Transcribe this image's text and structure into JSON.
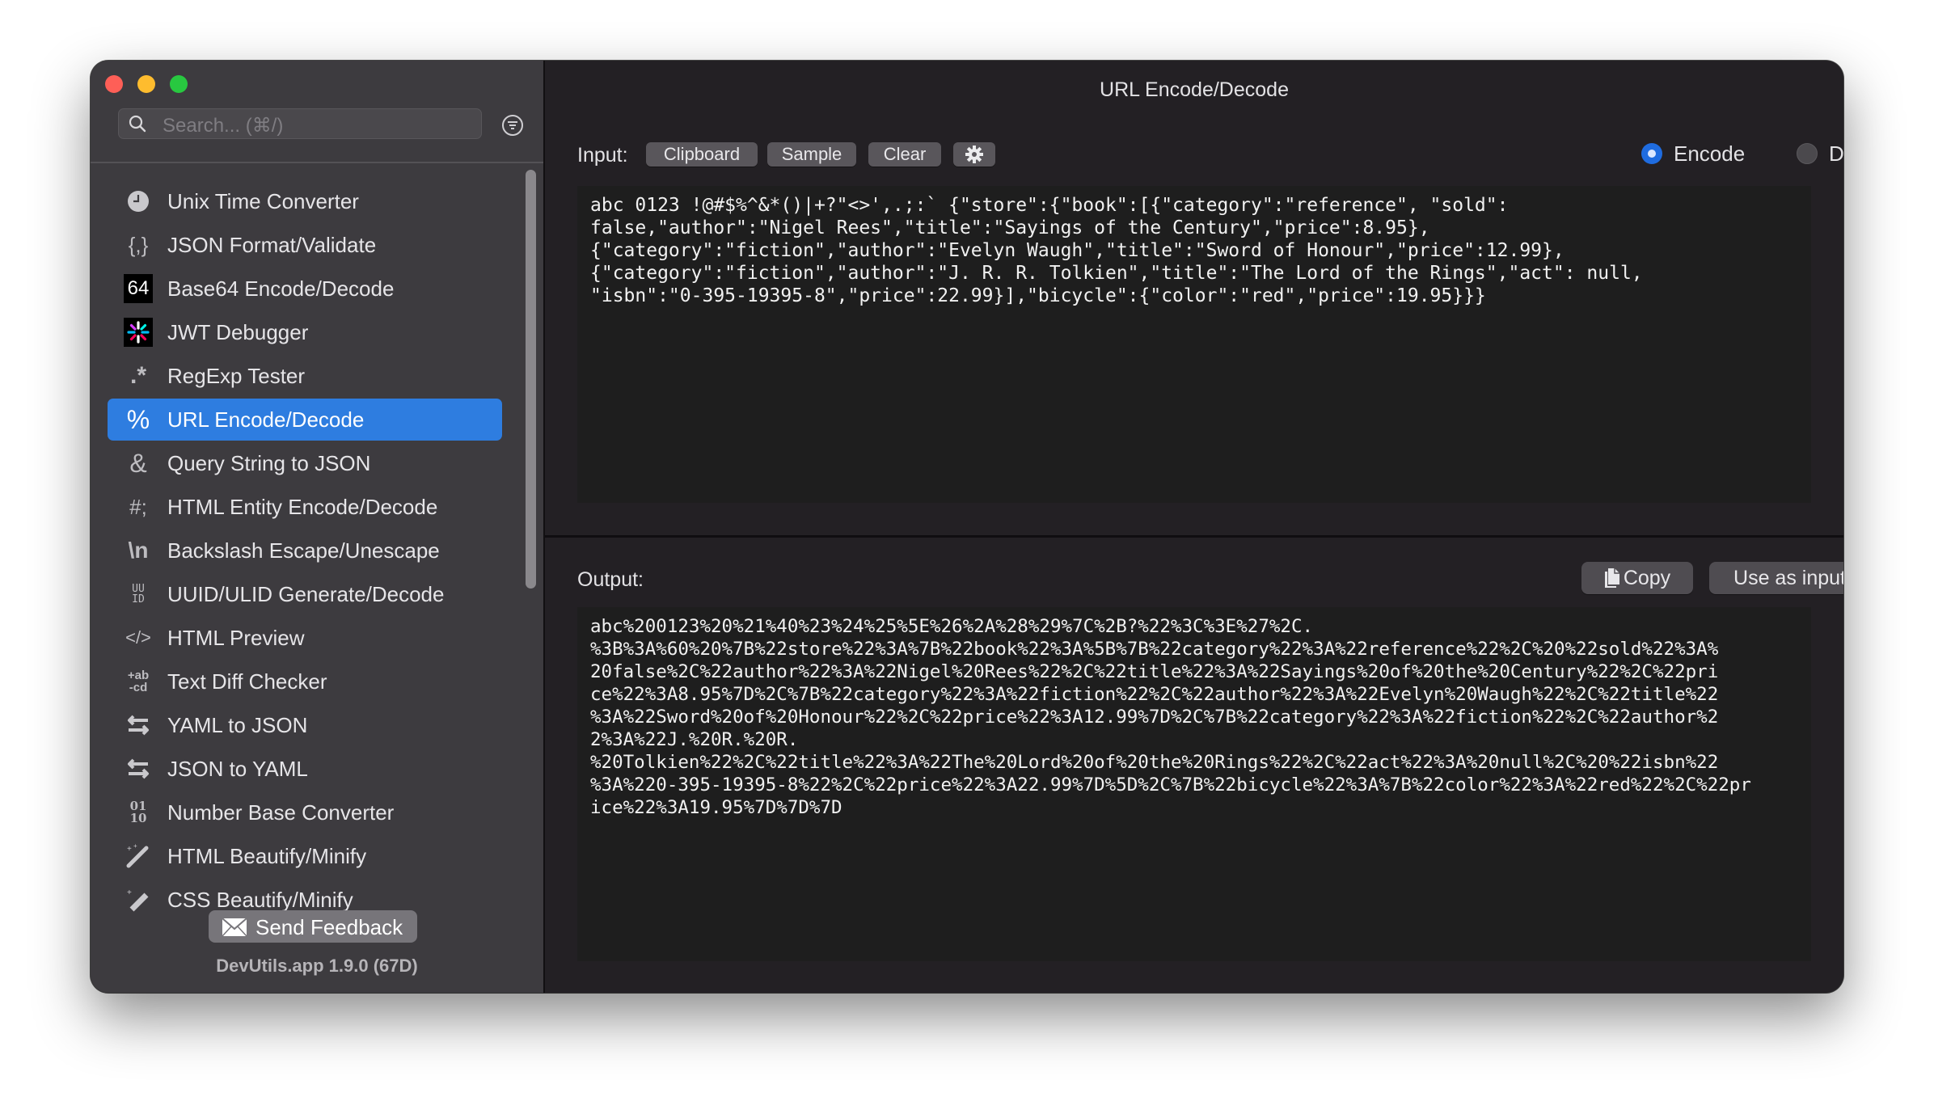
{
  "window": {
    "title": "URL Encode/Decode"
  },
  "sidebar": {
    "search_placeholder": "Search... (⌘/)",
    "items": [
      {
        "label": "Unix Time Converter",
        "icon": "clock-icon",
        "glyph": "🕘"
      },
      {
        "label": "JSON Format/Validate",
        "icon": "json-braces-icon",
        "glyph": "{,}"
      },
      {
        "label": "Base64 Encode/Decode",
        "icon": "base64-icon",
        "glyph": "64"
      },
      {
        "label": "JWT Debugger",
        "icon": "jwt-icon",
        "glyph": "✳"
      },
      {
        "label": "RegExp Tester",
        "icon": "regex-icon",
        "glyph": ".*"
      },
      {
        "label": "URL Encode/Decode",
        "icon": "percent-icon",
        "glyph": "%",
        "active": true
      },
      {
        "label": "Query String to JSON",
        "icon": "ampersand-icon",
        "glyph": "&"
      },
      {
        "label": "HTML Entity Encode/Decode",
        "icon": "hash-semicolon-icon",
        "glyph": "#;"
      },
      {
        "label": "Backslash Escape/Unescape",
        "icon": "backslash-n-icon",
        "glyph": "\\n"
      },
      {
        "label": "UUID/ULID Generate/Decode",
        "icon": "uuid-icon",
        "glyph": "UU ID"
      },
      {
        "label": "HTML Preview",
        "icon": "code-brackets-icon",
        "glyph": "</>"
      },
      {
        "label": "Text Diff Checker",
        "icon": "diff-icon",
        "glyph": "+ab -cd"
      },
      {
        "label": "YAML to JSON",
        "icon": "swap-arrows-icon",
        "glyph": "⇆"
      },
      {
        "label": "JSON to YAML",
        "icon": "swap-arrows-icon",
        "glyph": "⇆"
      },
      {
        "label": "Number Base Converter",
        "icon": "binary-icon",
        "glyph": "01 10"
      },
      {
        "label": "HTML Beautify/Minify",
        "icon": "magic-wand-icon",
        "glyph": "⁺╱"
      },
      {
        "label": "CSS Beautify/Minify",
        "icon": "magic-eraser-icon",
        "glyph": "⁺⧄"
      }
    ],
    "feedback_label": "Send Feedback",
    "version": "DevUtils.app 1.9.0 (67D)"
  },
  "input": {
    "label": "Input:",
    "buttons": {
      "clipboard": "Clipboard",
      "sample": "Sample",
      "clear": "Clear"
    },
    "modes": {
      "encode": "Encode",
      "decode": "Decode",
      "selected": "encode"
    },
    "text": "abc 0123 !@#$%^&*()|+?\"<>',.;:` {\"store\":{\"book\":[{\"category\":\"reference\", \"sold\":\nfalse,\"author\":\"Nigel Rees\",\"title\":\"Sayings of the Century\",\"price\":8.95},\n{\"category\":\"fiction\",\"author\":\"Evelyn Waugh\",\"title\":\"Sword of Honour\",\"price\":12.99},\n{\"category\":\"fiction\",\"author\":\"J. R. R. Tolkien\",\"title\":\"The Lord of the Rings\",\"act\": null,\n\"isbn\":\"0-395-19395-8\",\"price\":22.99}],\"bicycle\":{\"color\":\"red\",\"price\":19.95}}}"
  },
  "output": {
    "label": "Output:",
    "copy_label": "Copy",
    "use_as_input_label": "Use as input",
    "text": "abc%200123%20%21%40%23%24%25%5E%26%2A%28%29%7C%2B?%22%3C%3E%27%2C.\n%3B%3A%60%20%7B%22store%22%3A%7B%22book%22%3A%5B%7B%22category%22%3A%22reference%22%2C%20%22sold%22%3A%\n20false%2C%22author%22%3A%22Nigel%20Rees%22%2C%22title%22%3A%22Sayings%20of%20the%20Century%22%2C%22pri\nce%22%3A8.95%7D%2C%7B%22category%22%3A%22fiction%22%2C%22author%22%3A%22Evelyn%20Waugh%22%2C%22title%22\n%3A%22Sword%20of%20Honour%22%2C%22price%22%3A12.99%7D%2C%7B%22category%22%3A%22fiction%22%2C%22author%2\n2%3A%22J.%20R.%20R.\n%20Tolkien%22%2C%22title%22%3A%22The%20Lord%20of%20the%20Rings%22%2C%22act%22%3A%20null%2C%20%22isbn%22\n%3A%220-395-19395-8%22%2C%22price%22%3A22.99%7D%5D%2C%7B%22bicycle%22%3A%7B%22color%22%3A%22red%22%2C%22pr\nice%22%3A19.95%7D%7D%7D"
  },
  "colors": {
    "accent": "#2e7de0",
    "radio_selected": "#1f6ce0",
    "sidebar_bg": "#3d3b3f",
    "main_bg": "#232024",
    "editor_bg": "#1e1e1e"
  }
}
